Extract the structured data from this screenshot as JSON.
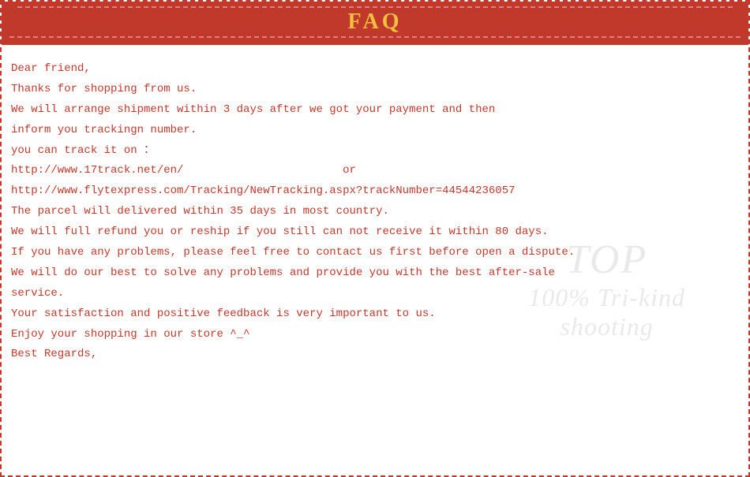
{
  "header": {
    "title": "FAQ",
    "bg_color": "#c0392b",
    "title_color": "#f0c040"
  },
  "content": {
    "lines": [
      "Dear friend,",
      "Thanks for shopping from us.",
      "We will arrange shipment within 3 days after we got your payment and then",
      "inform you trackingn number.",
      "you can track it on ：",
      "http://www.17track.net/en/                        or",
      "http://www.flytexpress.com/Tracking/NewTracking.aspx?trackNumber=44544236057",
      "The parcel will delivered within 35 days in most country.",
      "We will full refund you or reship if you still can not receive it within 80 days.",
      "If you have any problems, please feel free to contact us first before open a dispute.",
      "We will do our best to solve any problems and provide you with the best after-sale",
      "service.",
      "Your satisfaction and positive feedback is very important to us.",
      "Enjoy your shopping in our store ^_^",
      "Best Regards,"
    ],
    "text_color": "#c0392b"
  },
  "watermark": {
    "line1": "TOP",
    "line2": "100% Tri-kind",
    "line3": "shooting"
  }
}
